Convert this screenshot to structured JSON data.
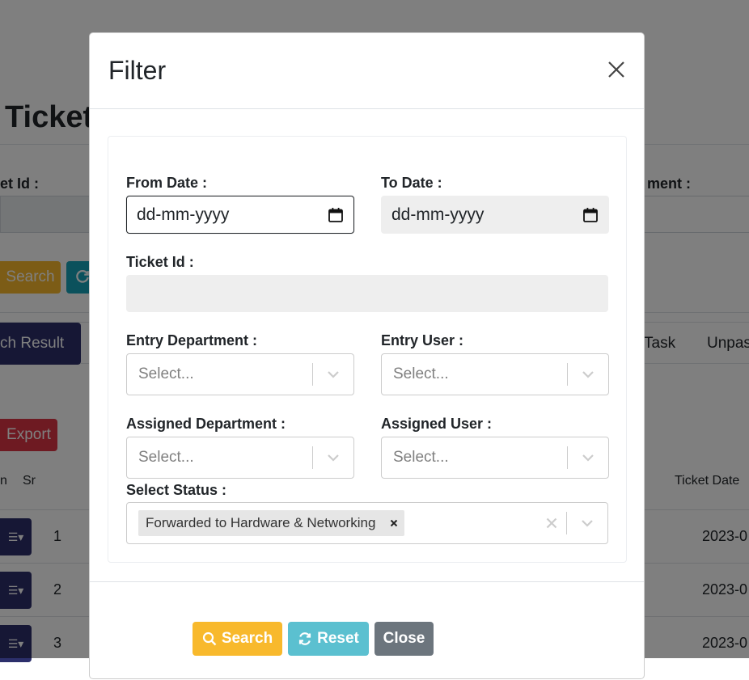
{
  "background": {
    "page_title": "Ticket",
    "label_ticket_id": "et Id :",
    "label_department": "ment :",
    "search_button": "Search",
    "tabs": [
      {
        "label": "ch Result",
        "active": true
      },
      {
        "label": "Task",
        "active": false
      },
      {
        "label": "Unpas",
        "active": false
      }
    ],
    "export_button": "Export",
    "table": {
      "headers": [
        "n",
        "Sr",
        "Ticket Date"
      ],
      "rows": [
        {
          "sr": "1",
          "date": "2023-0"
        },
        {
          "sr": "2",
          "date": "2023-0"
        },
        {
          "sr": "3",
          "date": "2023-0"
        }
      ]
    }
  },
  "modal": {
    "title": "Filter",
    "fields": {
      "from_date": {
        "label": "From Date :",
        "placeholder": "dd-mm-yyyy"
      },
      "to_date": {
        "label": "To Date :",
        "placeholder": "dd-mm-yyyy"
      },
      "ticket_id": {
        "label": "Ticket Id :",
        "value": ""
      },
      "entry_department": {
        "label": "Entry Department :",
        "placeholder": "Select..."
      },
      "entry_user": {
        "label": "Entry User :",
        "placeholder": "Select..."
      },
      "assigned_department": {
        "label": "Assigned Department :",
        "placeholder": "Select..."
      },
      "assigned_user": {
        "label": "Assigned User :",
        "placeholder": "Select..."
      },
      "status": {
        "label": "Select Status :",
        "selected": [
          "Forwarded to Hardware & Networking"
        ]
      }
    },
    "footer": {
      "search": "Search",
      "reset": "Reset",
      "close": "Close"
    }
  },
  "colors": {
    "search": "#f8b92c",
    "reset": "#5bc0d0",
    "close": "#6c757d",
    "export": "#dc3545",
    "primary_dark": "#2c2f6b",
    "teal": "#17a2b8"
  }
}
